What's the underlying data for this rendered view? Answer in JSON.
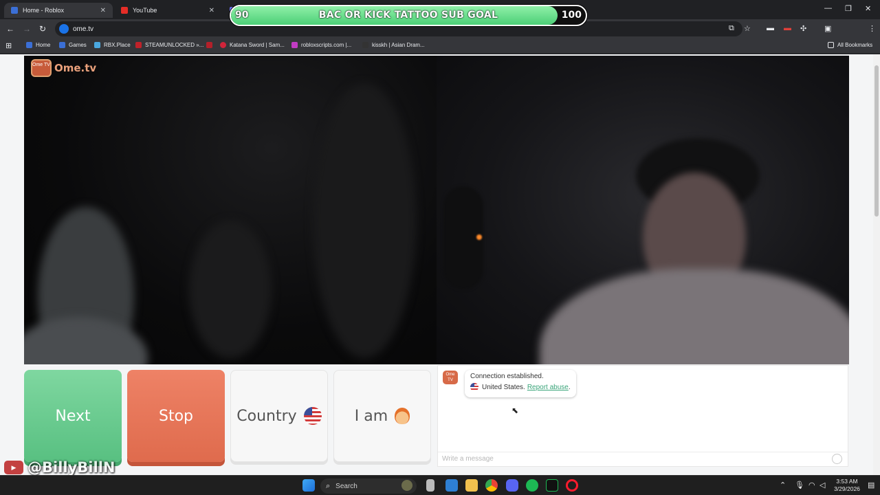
{
  "browser": {
    "tabs": [
      {
        "label": "Home - Roblox",
        "active": true
      },
      {
        "label": "YouTube",
        "active": false
      }
    ],
    "url": "ome.tv",
    "bookmarks": [
      "Home",
      "Games",
      "RBX.Place",
      "STEAMUNLOCKED »...",
      "Katana Sword | Sam...",
      "robloxscripts.com |...",
      "kisskh | Asian Dram..."
    ],
    "all_bookmarks": "All Bookmarks"
  },
  "goal": {
    "title": "BAC OR KICK TATTOO SUB GOAL",
    "min": "90",
    "max": "100",
    "progress": 0.92
  },
  "site": {
    "logo_badge": "Ome TV",
    "logo_text": "Ome.tv"
  },
  "controls": {
    "next": "Next",
    "stop": "Stop",
    "country": "Country",
    "iam": "I am"
  },
  "chat": {
    "avatar": "Ome TV",
    "connection": "Connection established.",
    "country_name": "United States.",
    "report": "Report abuse",
    "report_suffix": ".",
    "placeholder": "Write a message"
  },
  "watermark": {
    "channel": "@BillyBillN"
  },
  "taskbar": {
    "search": "Search",
    "time": "3:53 AM",
    "date": "3/29/2026"
  },
  "colors": {
    "next": "#6dcb92",
    "stop": "#e6735a",
    "goal_fill": "#5fd884",
    "report_link": "#3aa57a"
  }
}
